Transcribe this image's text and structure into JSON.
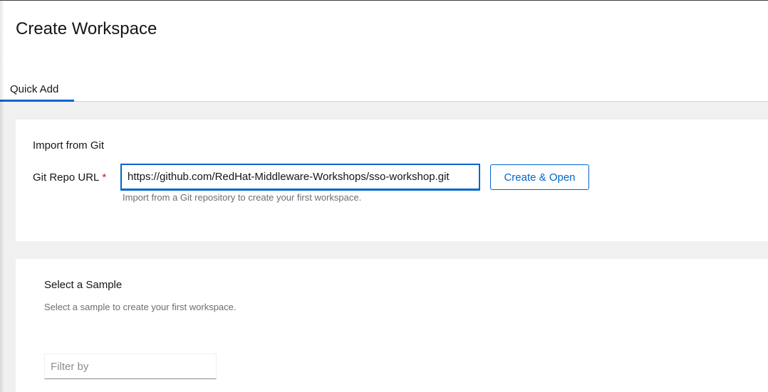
{
  "page": {
    "title": "Create Workspace"
  },
  "tabs": [
    {
      "label": "Quick Add",
      "active": true
    }
  ],
  "import_git": {
    "section_title": "Import from Git",
    "field_label": "Git Repo URL",
    "required_marker": "*",
    "url_value": "https://github.com/RedHat-Middleware-Workshops/sso-workshop.git",
    "helper_text": "Import from a Git repository to create your first workspace.",
    "create_button_label": "Create & Open"
  },
  "sample": {
    "section_title": "Select a Sample",
    "description": "Select a sample to create your first workspace.",
    "filter_placeholder": "Filter by"
  },
  "colors": {
    "accent": "#0066cc",
    "required": "#c9190b",
    "helper_text": "#6a6e73",
    "page_background": "#f0f0f0"
  }
}
